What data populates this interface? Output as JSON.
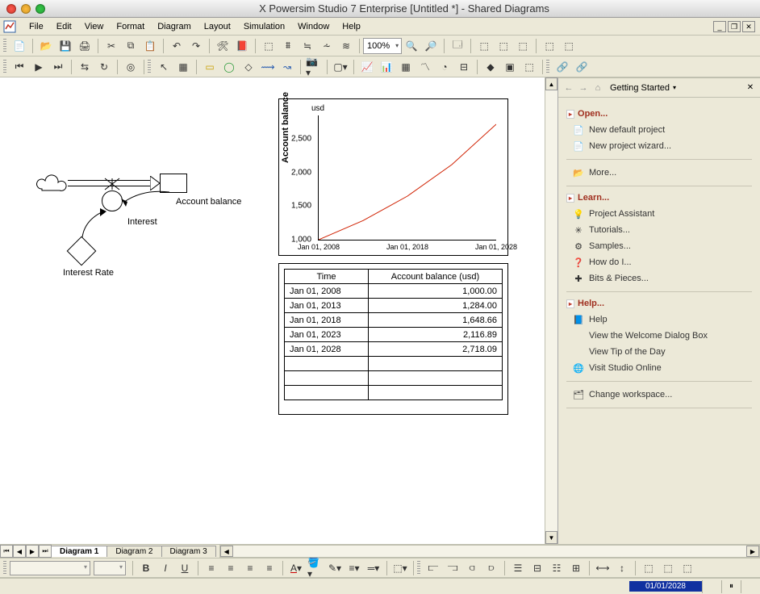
{
  "window": {
    "title": "X Powersim Studio 7 Enterprise [Untitled *] - Shared Diagrams"
  },
  "menus": [
    "File",
    "Edit",
    "View",
    "Format",
    "Diagram",
    "Layout",
    "Simulation",
    "Window",
    "Help"
  ],
  "toolbar1": {
    "zoom": "100%"
  },
  "tabs": {
    "items": [
      "Diagram 1",
      "Diagram 2",
      "Diagram 3"
    ],
    "active": 0
  },
  "sidebar": {
    "nav_title": "Getting Started",
    "sections": [
      {
        "title": "Open...",
        "links": [
          {
            "icon": "📄",
            "label": "New default project"
          },
          {
            "icon": "📄",
            "label": "New project wizard..."
          }
        ],
        "more": {
          "icon": "📂",
          "label": "More..."
        }
      },
      {
        "title": "Learn...",
        "links": [
          {
            "icon": "💡",
            "label": "Project Assistant"
          },
          {
            "icon": "✳",
            "label": "Tutorials..."
          },
          {
            "icon": "⚙",
            "label": "Samples..."
          },
          {
            "icon": "❓",
            "label": "How do I..."
          },
          {
            "icon": "✚",
            "label": "Bits & Pieces..."
          }
        ]
      },
      {
        "title": "Help...",
        "links": [
          {
            "icon": "📘",
            "label": "Help"
          },
          {
            "icon": "",
            "label": "View the Welcome Dialog Box"
          },
          {
            "icon": "",
            "label": "View Tip of the Day"
          },
          {
            "icon": "🌐",
            "label": "Visit Studio Online"
          }
        ],
        "more": {
          "icon": "🗂",
          "label": "Change workspace..."
        }
      }
    ]
  },
  "diagram": {
    "labels": {
      "account_balance": "Account balance",
      "interest": "Interest",
      "interest_rate": "Interest Rate"
    }
  },
  "chart_data": {
    "type": "line",
    "title": "Account balance",
    "ylabel": "Account balance",
    "unit": "usd",
    "x": [
      "Jan 01, 2008",
      "Jan 01, 2013",
      "Jan 01, 2018",
      "Jan 01, 2023",
      "Jan 01, 2028"
    ],
    "x_tick_labels": [
      "Jan 01, 2008",
      "Jan 01, 2018",
      "Jan 01, 2028"
    ],
    "y_ticks": [
      1000,
      1500,
      2000,
      2500
    ],
    "y_tick_labels": [
      "1,000",
      "1,500",
      "2,000",
      "2,500"
    ],
    "ylim": [
      1000,
      2850
    ],
    "series": [
      {
        "name": "Account balance",
        "color": "#d02000",
        "values": [
          1000.0,
          1284.0,
          1648.66,
          2116.89,
          2718.09
        ]
      }
    ]
  },
  "table": {
    "headers": [
      "Time",
      "Account balance (usd)"
    ],
    "rows": [
      [
        "Jan 01, 2008",
        "1,000.00"
      ],
      [
        "Jan 01, 2013",
        "1,284.00"
      ],
      [
        "Jan 01, 2018",
        "1,648.66"
      ],
      [
        "Jan 01, 2023",
        "2,116.89"
      ],
      [
        "Jan 01, 2028",
        "2,718.09"
      ]
    ],
    "blank_rows": 3
  },
  "status": {
    "date": "01/01/2028"
  }
}
